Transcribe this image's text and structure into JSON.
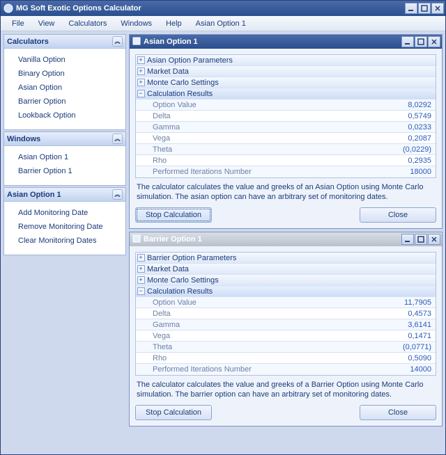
{
  "app": {
    "title": "MG Soft Exotic Options Calculator"
  },
  "menubar": [
    "File",
    "View",
    "Calculators",
    "Windows",
    "Help",
    "Asian Option 1"
  ],
  "sidebar": {
    "calculators": {
      "title": "Calculators",
      "items": [
        "Vanilla Option",
        "Binary Option",
        "Asian Option",
        "Barrier Option",
        "Lookback Option"
      ]
    },
    "windows": {
      "title": "Windows",
      "items": [
        "Asian Option 1",
        "Barrier Option 1"
      ]
    },
    "asian": {
      "title": "Asian Option 1",
      "items": [
        "Add Monitoring Date",
        "Remove Monitoring Date",
        "Clear Monitoring Dates"
      ]
    }
  },
  "sections": {
    "s0": "Asian Option Parameters",
    "s1": "Market Data",
    "s2": "Monte Carlo Settings",
    "s3": "Calculation Results",
    "b0": "Barrier Option Parameters",
    "labels": {
      "optionValue": "Option Value",
      "delta": "Delta",
      "gamma": "Gamma",
      "vega": "Vega",
      "theta": "Theta",
      "rho": "Rho",
      "iterations": "Performed Iterations Number"
    }
  },
  "asianWin": {
    "title": "Asian Option 1",
    "results": {
      "optionValue": "8,0292",
      "delta": "0,5749",
      "gamma": "0,0233",
      "vega": "0,2087",
      "theta": "(0,0229)",
      "rho": "0,2935",
      "iterations": "18000"
    },
    "desc": "The calculator calculates the value and greeks of an Asian Option using Monte Carlo simulation. The asian option can have an arbitrary set of monitoring dates.",
    "stop": "Stop Calculation",
    "close": "Close"
  },
  "barrierWin": {
    "title": "Barrier Option 1",
    "results": {
      "optionValue": "11,7905",
      "delta": "0,4573",
      "gamma": "3,6141",
      "vega": "0,1471",
      "theta": "(0,0771)",
      "rho": "0,5090",
      "iterations": "14000"
    },
    "desc": "The calculator calculates the value and greeks of a Barrier Option using Monte Carlo simulation. The barrier option can have an arbitrary set of monitoring dates.",
    "stop": "Stop Calculation",
    "close": "Close"
  }
}
